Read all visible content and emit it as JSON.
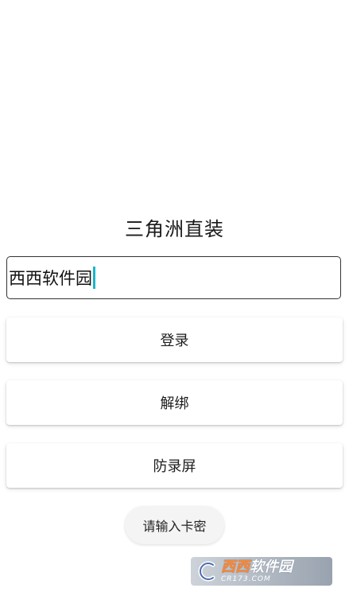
{
  "app": {
    "title": "三角洲直装"
  },
  "card_input": {
    "value": "西西软件园"
  },
  "buttons": {
    "login_label": "登录",
    "unbind_label": "解绑",
    "anti_record_label": "防录屏"
  },
  "toast": {
    "message": "请输入卡密"
  },
  "watermark": {
    "brand_accent": "西西",
    "brand_rest": "软件园",
    "domain": "CR173.COM"
  },
  "colors": {
    "caret": "#19b6c9",
    "watermark_accent": "#ff7a1a"
  }
}
